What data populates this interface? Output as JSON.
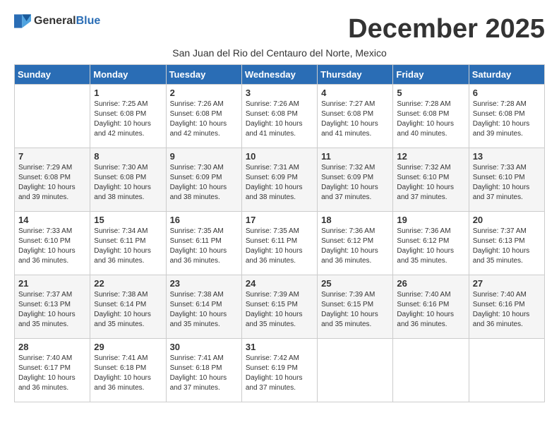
{
  "header": {
    "logo_general": "General",
    "logo_blue": "Blue",
    "month_title": "December 2025",
    "subtitle": "San Juan del Rio del Centauro del Norte, Mexico"
  },
  "days_of_week": [
    "Sunday",
    "Monday",
    "Tuesday",
    "Wednesday",
    "Thursday",
    "Friday",
    "Saturday"
  ],
  "weeks": [
    [
      {
        "day": "",
        "info": ""
      },
      {
        "day": "1",
        "info": "Sunrise: 7:25 AM\nSunset: 6:08 PM\nDaylight: 10 hours\nand 42 minutes."
      },
      {
        "day": "2",
        "info": "Sunrise: 7:26 AM\nSunset: 6:08 PM\nDaylight: 10 hours\nand 42 minutes."
      },
      {
        "day": "3",
        "info": "Sunrise: 7:26 AM\nSunset: 6:08 PM\nDaylight: 10 hours\nand 41 minutes."
      },
      {
        "day": "4",
        "info": "Sunrise: 7:27 AM\nSunset: 6:08 PM\nDaylight: 10 hours\nand 41 minutes."
      },
      {
        "day": "5",
        "info": "Sunrise: 7:28 AM\nSunset: 6:08 PM\nDaylight: 10 hours\nand 40 minutes."
      },
      {
        "day": "6",
        "info": "Sunrise: 7:28 AM\nSunset: 6:08 PM\nDaylight: 10 hours\nand 39 minutes."
      }
    ],
    [
      {
        "day": "7",
        "info": "Sunrise: 7:29 AM\nSunset: 6:08 PM\nDaylight: 10 hours\nand 39 minutes."
      },
      {
        "day": "8",
        "info": "Sunrise: 7:30 AM\nSunset: 6:08 PM\nDaylight: 10 hours\nand 38 minutes."
      },
      {
        "day": "9",
        "info": "Sunrise: 7:30 AM\nSunset: 6:09 PM\nDaylight: 10 hours\nand 38 minutes."
      },
      {
        "day": "10",
        "info": "Sunrise: 7:31 AM\nSunset: 6:09 PM\nDaylight: 10 hours\nand 38 minutes."
      },
      {
        "day": "11",
        "info": "Sunrise: 7:32 AM\nSunset: 6:09 PM\nDaylight: 10 hours\nand 37 minutes."
      },
      {
        "day": "12",
        "info": "Sunrise: 7:32 AM\nSunset: 6:10 PM\nDaylight: 10 hours\nand 37 minutes."
      },
      {
        "day": "13",
        "info": "Sunrise: 7:33 AM\nSunset: 6:10 PM\nDaylight: 10 hours\nand 37 minutes."
      }
    ],
    [
      {
        "day": "14",
        "info": "Sunrise: 7:33 AM\nSunset: 6:10 PM\nDaylight: 10 hours\nand 36 minutes."
      },
      {
        "day": "15",
        "info": "Sunrise: 7:34 AM\nSunset: 6:11 PM\nDaylight: 10 hours\nand 36 minutes."
      },
      {
        "day": "16",
        "info": "Sunrise: 7:35 AM\nSunset: 6:11 PM\nDaylight: 10 hours\nand 36 minutes."
      },
      {
        "day": "17",
        "info": "Sunrise: 7:35 AM\nSunset: 6:11 PM\nDaylight: 10 hours\nand 36 minutes."
      },
      {
        "day": "18",
        "info": "Sunrise: 7:36 AM\nSunset: 6:12 PM\nDaylight: 10 hours\nand 36 minutes."
      },
      {
        "day": "19",
        "info": "Sunrise: 7:36 AM\nSunset: 6:12 PM\nDaylight: 10 hours\nand 35 minutes."
      },
      {
        "day": "20",
        "info": "Sunrise: 7:37 AM\nSunset: 6:13 PM\nDaylight: 10 hours\nand 35 minutes."
      }
    ],
    [
      {
        "day": "21",
        "info": "Sunrise: 7:37 AM\nSunset: 6:13 PM\nDaylight: 10 hours\nand 35 minutes."
      },
      {
        "day": "22",
        "info": "Sunrise: 7:38 AM\nSunset: 6:14 PM\nDaylight: 10 hours\nand 35 minutes."
      },
      {
        "day": "23",
        "info": "Sunrise: 7:38 AM\nSunset: 6:14 PM\nDaylight: 10 hours\nand 35 minutes."
      },
      {
        "day": "24",
        "info": "Sunrise: 7:39 AM\nSunset: 6:15 PM\nDaylight: 10 hours\nand 35 minutes."
      },
      {
        "day": "25",
        "info": "Sunrise: 7:39 AM\nSunset: 6:15 PM\nDaylight: 10 hours\nand 35 minutes."
      },
      {
        "day": "26",
        "info": "Sunrise: 7:40 AM\nSunset: 6:16 PM\nDaylight: 10 hours\nand 36 minutes."
      },
      {
        "day": "27",
        "info": "Sunrise: 7:40 AM\nSunset: 6:16 PM\nDaylight: 10 hours\nand 36 minutes."
      }
    ],
    [
      {
        "day": "28",
        "info": "Sunrise: 7:40 AM\nSunset: 6:17 PM\nDaylight: 10 hours\nand 36 minutes."
      },
      {
        "day": "29",
        "info": "Sunrise: 7:41 AM\nSunset: 6:18 PM\nDaylight: 10 hours\nand 36 minutes."
      },
      {
        "day": "30",
        "info": "Sunrise: 7:41 AM\nSunset: 6:18 PM\nDaylight: 10 hours\nand 37 minutes."
      },
      {
        "day": "31",
        "info": "Sunrise: 7:42 AM\nSunset: 6:19 PM\nDaylight: 10 hours\nand 37 minutes."
      },
      {
        "day": "",
        "info": ""
      },
      {
        "day": "",
        "info": ""
      },
      {
        "day": "",
        "info": ""
      }
    ]
  ]
}
